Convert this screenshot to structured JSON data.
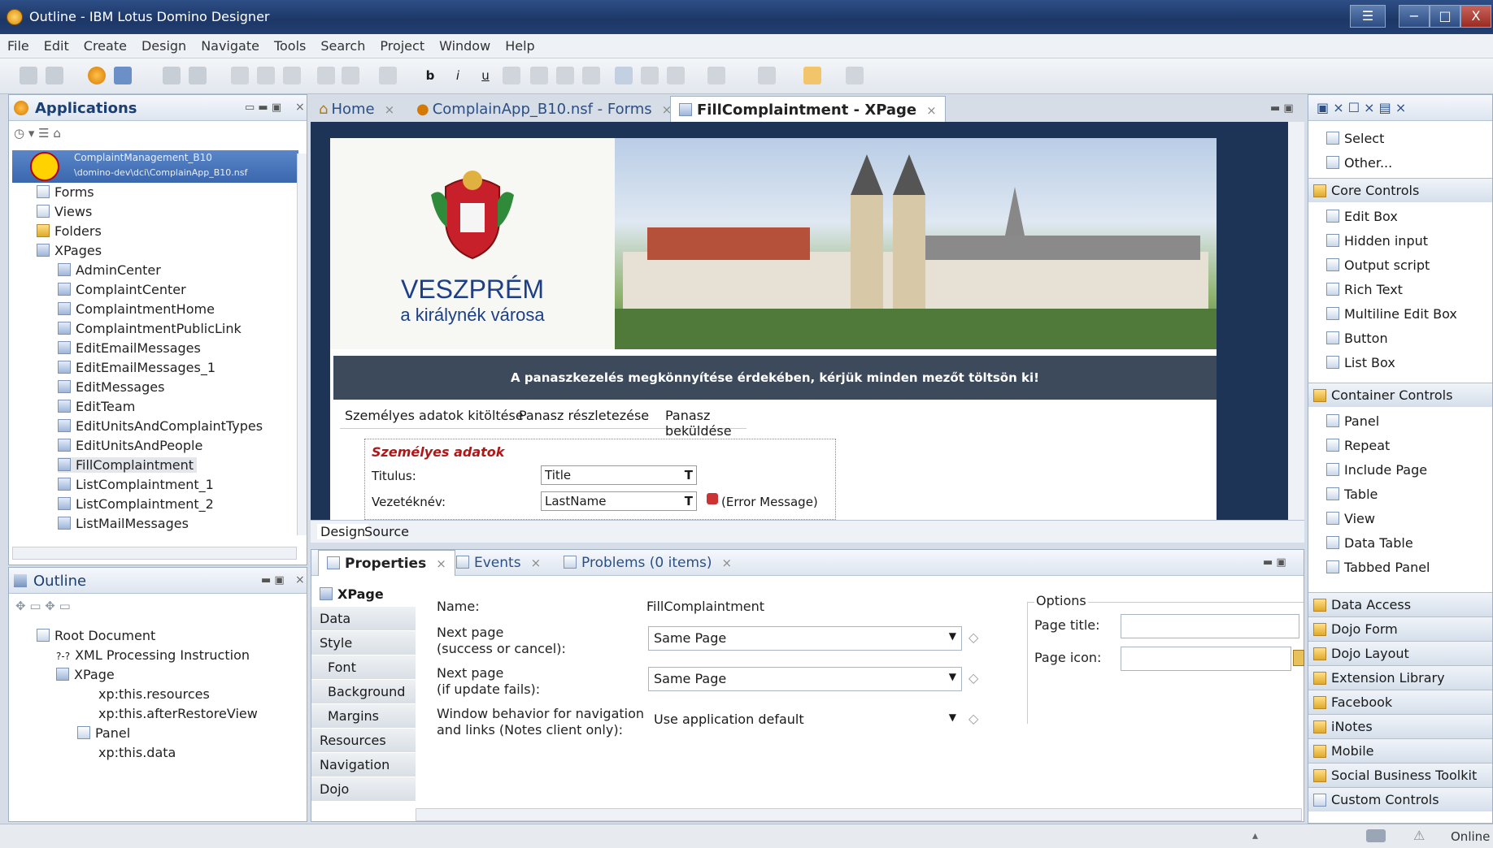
{
  "window": {
    "title": "Outline - IBM Lotus Domino Designer",
    "controls": [
      "☰",
      "−",
      "□",
      "X"
    ]
  },
  "menu": [
    "File",
    "Edit",
    "Create",
    "Design",
    "Navigate",
    "Tools",
    "Search",
    "Project",
    "Window",
    "Help"
  ],
  "applications": {
    "title": "Applications",
    "db_name": "ComplaintManagement_B10",
    "db_path": "\\domino-dev\\dci\\ComplainApp_B10.nsf",
    "items": [
      {
        "label": "Forms",
        "icon": "form-icon"
      },
      {
        "label": "Views",
        "icon": "view-icon"
      },
      {
        "label": "Folders",
        "icon": "folder-icon"
      },
      {
        "label": "XPages",
        "icon": "xpage-icon"
      }
    ],
    "xpages": [
      "AdminCenter",
      "ComplaintCenter",
      "ComplaintmentHome",
      "ComplaintmentPublicLink",
      "EditEmailMessages",
      "EditEmailMessages_1",
      "EditMessages",
      "EditTeam",
      "EditUnitsAndComplaintTypes",
      "EditUnitsAndPeople",
      "FillComplaintment",
      "ListComplaintment_1",
      "ListComplaintment_2",
      "ListMailMessages"
    ]
  },
  "outline": {
    "title": "Outline",
    "items": [
      "Root Document",
      "XML Processing Instruction",
      "XPage",
      "xp:this.resources",
      "xp:this.afterRestoreView",
      "Panel",
      "xp:this.data"
    ]
  },
  "editor": {
    "tabs": [
      "Home",
      "ComplainApp_B10.nsf - Forms",
      "FillComplaintment - XPage"
    ],
    "banner_title": "VESZPRÉM",
    "banner_sub": "a királynék városa",
    "notice": "A panaszkezelés megkönnyítése érdekében, kérjük minden mezőt töltsön ki!",
    "form_tabs": [
      "Személyes adatok kitöltése",
      "Panasz részletezése",
      "Panasz beküldése"
    ],
    "section": "Személyes adatok",
    "rows": [
      {
        "label": "Titulus:",
        "field": "Title",
        "extra": ""
      },
      {
        "label": "Vezetéknév:",
        "field": "LastName",
        "extra": "(Error Message)"
      }
    ],
    "mode_tabs": [
      "Design",
      "Source"
    ]
  },
  "palette": {
    "top": [
      "Select",
      "Other..."
    ],
    "core_title": "Core Controls",
    "core": [
      "Edit Box",
      "Hidden input",
      "Output script",
      "Rich Text",
      "Multiline Edit Box",
      "Button",
      "List Box"
    ],
    "container_title": "Container Controls",
    "container": [
      "Panel",
      "Repeat",
      "Include Page",
      "Table",
      "View",
      "Data Table",
      "Tabbed Panel"
    ],
    "categories": [
      "Data Access",
      "Dojo Form",
      "Dojo Layout",
      "Extension Library",
      "Facebook",
      "iNotes",
      "Mobile",
      "Social Business Toolkit",
      "Custom Controls"
    ]
  },
  "properties": {
    "tabs": [
      "Properties",
      "Events",
      "Problems (0 items)"
    ],
    "side": [
      "XPage",
      "Data",
      "Style",
      "Font",
      "Background",
      "Margins",
      "Resources",
      "Navigation",
      "Dojo"
    ],
    "name_label": "Name:",
    "name_value": "FillComplaintment",
    "next_page_label1": "Next page",
    "next_page_label1b": "(success or cancel):",
    "next_page_value1": "Same Page",
    "next_page_label2": "Next page",
    "next_page_label2b": "(if update fails):",
    "next_page_value2": "Same Page",
    "window_label1": "Window behavior for navigation",
    "window_label2": "and links (Notes client only):",
    "window_value": "Use application default",
    "options_title": "Options",
    "page_title_label": "Page title:",
    "page_icon_label": "Page icon:"
  },
  "status": {
    "online": "Online"
  }
}
